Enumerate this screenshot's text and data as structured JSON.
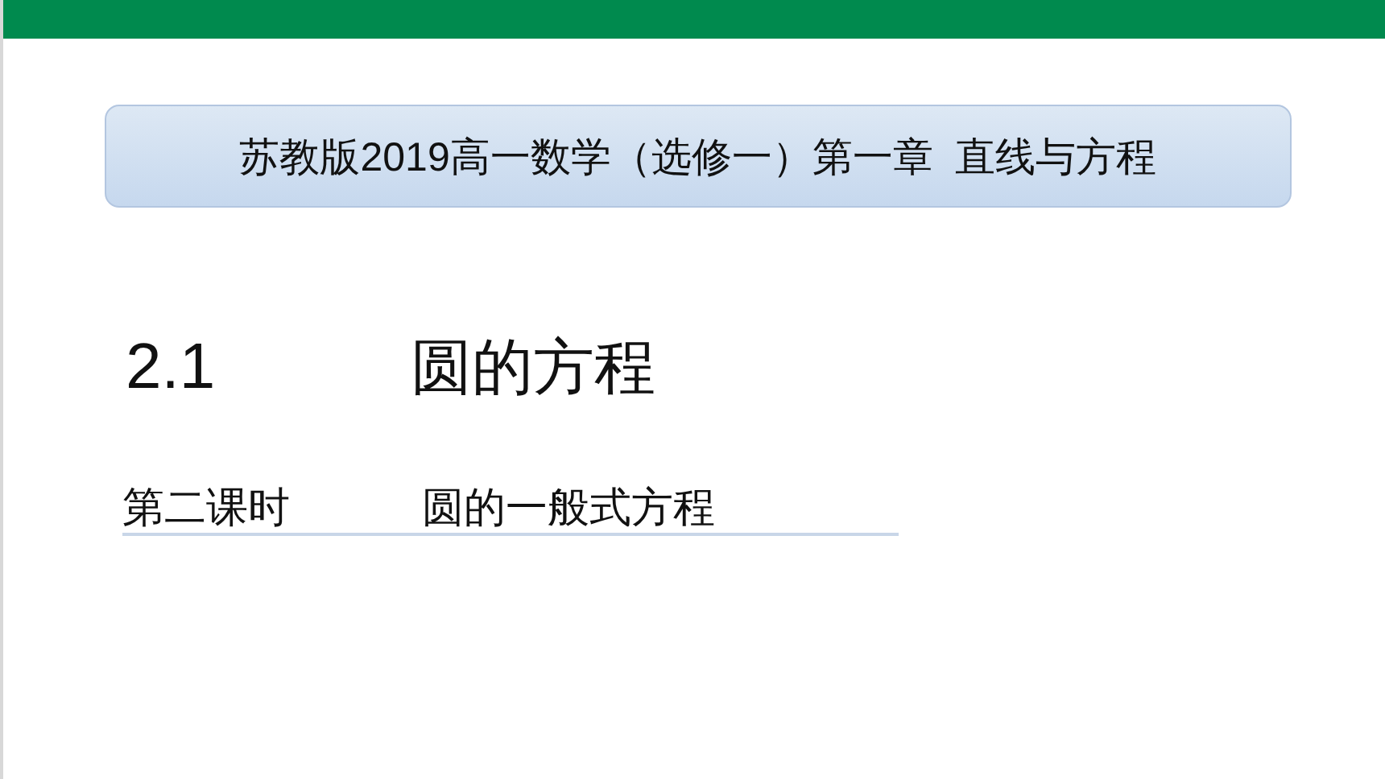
{
  "banner": {
    "title": "苏教版2019高一数学（选修一）第一章  直线与方程"
  },
  "section": {
    "number": "2.1",
    "title": "圆的方程"
  },
  "lesson": {
    "period": "第二课时",
    "title": "圆的一般式方程"
  }
}
